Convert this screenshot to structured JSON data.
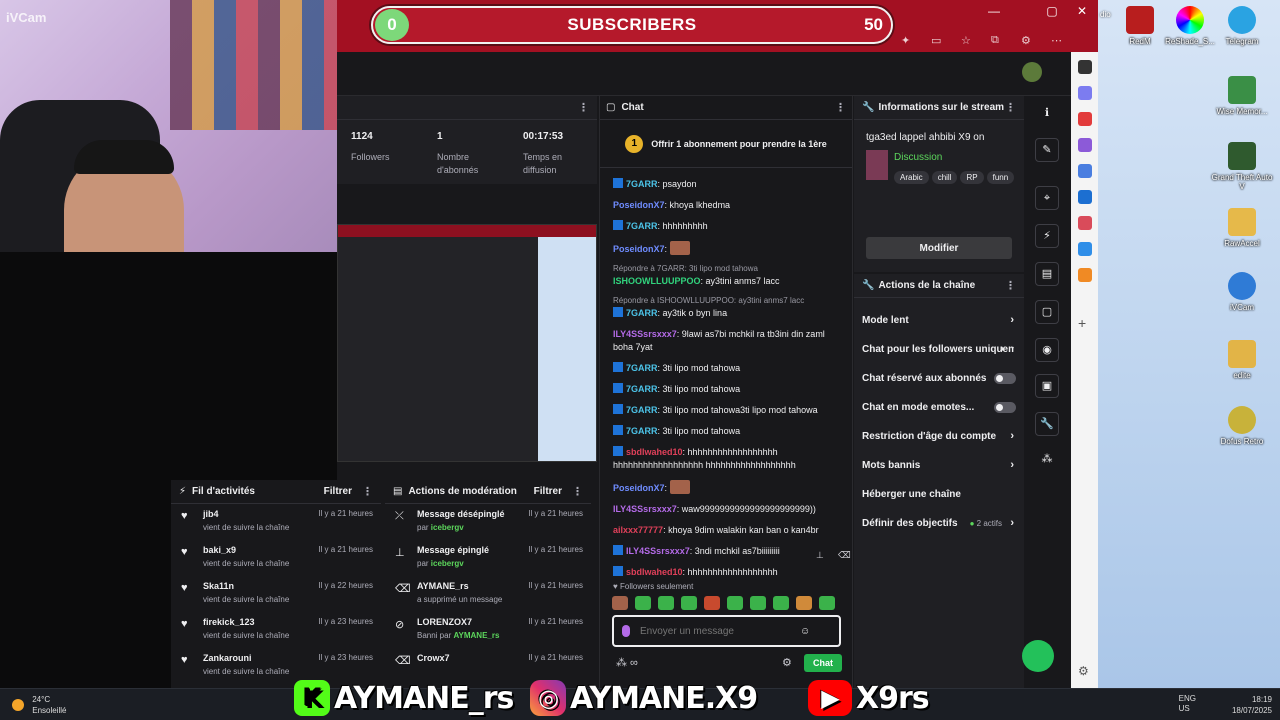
{
  "webcam": {
    "watermark": "iVCam"
  },
  "window": {
    "subscriber_goal": {
      "current": "0",
      "label": "SUBSCRIBERS",
      "target": "50"
    },
    "controls": [
      "—",
      "▢",
      "✕"
    ]
  },
  "stats": {
    "followers_value": "1124",
    "followers_label": "Followers",
    "subs_value": "1",
    "subs_label": "Nombre d'abonnés",
    "time_value": "00:17:53",
    "time_label": "Temps en diffusion"
  },
  "preview": {
    "footer": "KAYMANE_rs  AYMANE.X9  x9rs"
  },
  "activity": {
    "title": "Fil d'activités",
    "filter": "Filtrer",
    "items": [
      {
        "name": "jib4",
        "sub": "vient de suivre la chaîne",
        "time": "Il y a 21 heures"
      },
      {
        "name": "baki_x9",
        "sub": "vient de suivre la chaîne",
        "time": "Il y a 21 heures"
      },
      {
        "name": "Ska11n",
        "sub": "vient de suivre la chaîne",
        "time": "Il y a 22 heures"
      },
      {
        "name": "firekick_123",
        "sub": "vient de suivre la chaîne",
        "time": "Il y a 23 heures"
      },
      {
        "name": "Zankarouni",
        "sub": "vient de suivre la chaîne",
        "time": "Il y a 23 heures"
      }
    ]
  },
  "moderation": {
    "title": "Actions de modération",
    "filter": "Filtrer",
    "items": [
      {
        "name": "Message désépinglé",
        "by_prefix": "par",
        "by": "icebergv",
        "time": "Il y a 21 heures"
      },
      {
        "name": "Message épinglé",
        "by_prefix": "par",
        "by": "icebergv",
        "time": "Il y a 21 heures"
      },
      {
        "name": "AYMANE_rs",
        "by_prefix": "a supprimé un message",
        "by": "",
        "time": "Il y a 21 heures"
      },
      {
        "name": "LORENZOX7",
        "by_prefix": "Banni par",
        "by": "AYMANE_rs",
        "time": "Il y a 21 heures"
      },
      {
        "name": "Crowx7",
        "by_prefix": "",
        "by": "",
        "time": "Il y a 21 heures"
      }
    ]
  },
  "chat": {
    "title": "Chat",
    "offer_num": "1",
    "offer": "Offrir 1 abonnement pour prendre la 1ère",
    "messages": [
      {
        "user": "7GARR",
        "color": "#4cc3e8",
        "badge": true,
        "text": "psaydon"
      },
      {
        "user": "PoseidonX7",
        "color": "#6f8cff",
        "badge": false,
        "text": "khoya lkhedma"
      },
      {
        "user": "7GARR",
        "color": "#4cc3e8",
        "badge": true,
        "text": "hhhhhhhhh"
      },
      {
        "user": "PoseidonX7",
        "color": "#6f8cff",
        "badge": false,
        "text": "",
        "emote": true
      },
      {
        "reply": "Répondre à 7GARR: 3ti lipo mod tahowa",
        "user": "ISHOOWLLUUPPOO",
        "color": "#31d37d",
        "badge": false,
        "text": "ay3tini anms7 lacc"
      },
      {
        "reply": "Répondre à ISHOOWLLUUPPOO: ay3tini anms7 lacc",
        "user": "7GARR",
        "color": "#4cc3e8",
        "badge": true,
        "text": "ay3tik o byn lina"
      },
      {
        "user": "ILY4SSsrsxxx7",
        "color": "#b46be8",
        "badge": false,
        "text": "9lawi as7bi mchkil ra tb3ini din zaml boha 7yat"
      },
      {
        "user": "7GARR",
        "color": "#4cc3e8",
        "badge": true,
        "text": "3ti lipo mod tahowa"
      },
      {
        "user": "7GARR",
        "color": "#4cc3e8",
        "badge": true,
        "text": "3ti lipo mod tahowa"
      },
      {
        "user": "7GARR",
        "color": "#4cc3e8",
        "badge": true,
        "text": "3ti lipo mod tahowa3ti lipo mod tahowa"
      },
      {
        "user": "7GARR",
        "color": "#4cc3e8",
        "badge": true,
        "text": "3ti lipo mod tahowa"
      },
      {
        "user": "sbdlwahed10",
        "color": "#e0405a",
        "badge": true,
        "text": "hhhhhhhhhhhhhhhhhh hhhhhhhhhhhhhhhhhh hhhhhhhhhhhhhhhhhh"
      },
      {
        "user": "PoseidonX7",
        "color": "#6f8cff",
        "badge": false,
        "text": "",
        "emote": true
      },
      {
        "user": "ILY4SSsrsxxx7",
        "color": "#b46be8",
        "badge": false,
        "text": "waw9999999999999999999999))"
      },
      {
        "user": "ailxxx77777",
        "color": "#e0405a",
        "badge": false,
        "text": "khoya 9dim walakin kan ban o kan4br"
      },
      {
        "user": "ILY4SSsrsxxx7",
        "color": "#b46be8",
        "badge": true,
        "text": "3ndi mchkil as7biiiiiiiii"
      },
      {
        "user": "sbdlwahed10",
        "color": "#e0405a",
        "badge": true,
        "text": "hhhhhhhhhhhhhhhhhh"
      }
    ],
    "followers_only": "Followers seulement",
    "input_placeholder": "Envoyer un message",
    "send_label": "Chat"
  },
  "stream_info": {
    "title": "Informations sur le stream",
    "stream_title": "tga3ed lappel ahbibi X9 on",
    "category": "Discussion",
    "tags": [
      "Arabic",
      "chill",
      "RP",
      "funn"
    ],
    "modify": "Modifier"
  },
  "channel_actions": {
    "title": "Actions de la chaîne",
    "items": [
      {
        "label": "Mode lent",
        "type": "chevron"
      },
      {
        "label": "Chat pour les followers uniquement",
        "type": "chevron"
      },
      {
        "label": "Chat réservé aux abonnés",
        "type": "toggle"
      },
      {
        "label": "Chat en mode emotes...",
        "type": "toggle"
      },
      {
        "label": "Restriction d'âge du compte",
        "type": "chevron"
      },
      {
        "label": "Mots bannis",
        "type": "chevron"
      },
      {
        "label": "Héberger une chaîne",
        "type": "none"
      },
      {
        "label": "Définir des objectifs",
        "type": "chevron",
        "extra": "2 actifs"
      }
    ]
  },
  "desktop": {
    "top_icons": [
      "RedM",
      "ReShade_S...",
      "Telegram"
    ],
    "icons": [
      "Wise Memor...",
      "Grand Theft Auto V",
      "RawAccel",
      "iVCam",
      "edite",
      "Dofus Retro"
    ],
    "top_left_label": "dio"
  },
  "taskbar": {
    "temp": "24°C",
    "weather": "Ensoleillé",
    "lang": "ENG",
    "region": "US",
    "time": "18:19",
    "date": "18/07/2025"
  },
  "overlay": {
    "brand1": "AYMANE_rs",
    "brand2": "AYMANE.X9",
    "brand3": "X9rs"
  },
  "colors": {
    "accent_green": "#22b14c",
    "brand_red": "#a31022",
    "twitch_dark": "#18181b"
  }
}
